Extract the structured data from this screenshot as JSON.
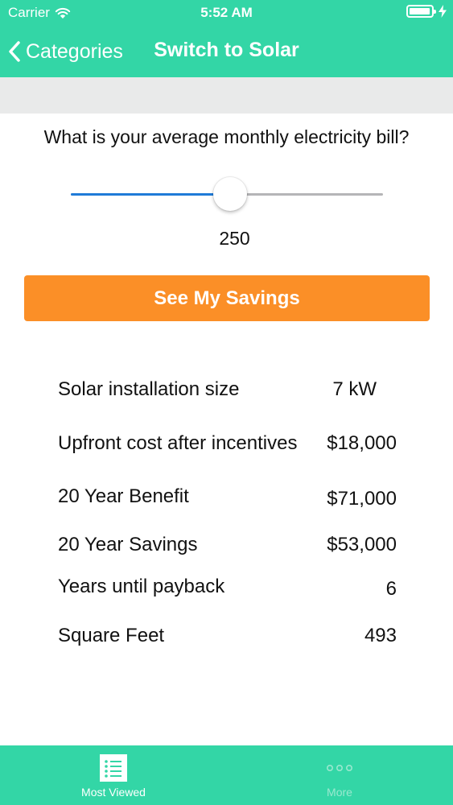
{
  "status_bar": {
    "carrier": "Carrier",
    "time": "5:52 AM",
    "battery_level": 0.95
  },
  "nav": {
    "back_label": "Categories",
    "title": "Switch to Solar"
  },
  "question": "What is your average monthly electricity bill?",
  "slider": {
    "value": "250",
    "fill_fraction": 0.51
  },
  "button_label": "See My Savings",
  "results": [
    {
      "label": "Solar installation size",
      "value": "7 kW"
    },
    {
      "label": "Upfront cost after incentives",
      "value": "$18,000"
    },
    {
      "label": "20 Year Benefit",
      "value": "$71,000"
    },
    {
      "label": "20 Year Savings",
      "value": "$53,000"
    },
    {
      "label": "Years until payback",
      "value": "6"
    },
    {
      "label": "Square Feet",
      "value": "493"
    }
  ],
  "tab_bar": [
    {
      "label": "Most Viewed",
      "icon": "list-icon",
      "selected": true
    },
    {
      "label": "More",
      "icon": "more-icon",
      "selected": false
    }
  ],
  "colors": {
    "accent": "#33d6a6",
    "button": "#fb8f27",
    "slider_fill": "#1f7bd8",
    "band": "#e9eaea"
  }
}
